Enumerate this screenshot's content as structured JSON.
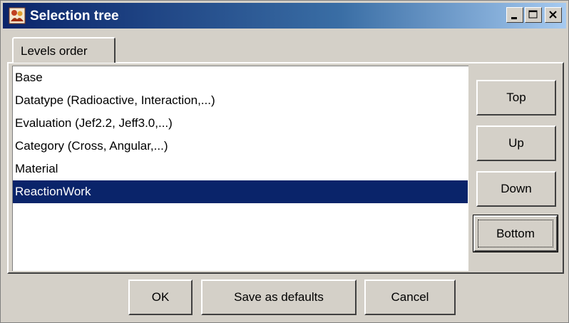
{
  "window": {
    "title": "Selection tree",
    "icon": "app-icon",
    "controls": [
      "minimize-icon",
      "maximize-icon",
      "close-icon"
    ]
  },
  "tabs": [
    {
      "label": "Levels order",
      "selected": true
    }
  ],
  "levels": [
    {
      "label": "Base"
    },
    {
      "label": "Datatype (Radioactive, Interaction,...)"
    },
    {
      "label": "Evaluation (Jef2.2, Jeff3.0,...)"
    },
    {
      "label": "Category (Cross, Angular,...)"
    },
    {
      "label": "Material"
    },
    {
      "label": "ReactionWork",
      "selected": true
    }
  ],
  "side_buttons": {
    "top": "Top",
    "up": "Up",
    "down": "Down",
    "bottom": "Bottom"
  },
  "footer_buttons": {
    "ok": "OK",
    "save_defaults": "Save as defaults",
    "cancel": "Cancel"
  },
  "colors": {
    "selection": "#0a246a",
    "title_start": "#0a246a",
    "title_end": "#a6caf0",
    "face": "#d4d0c8"
  }
}
